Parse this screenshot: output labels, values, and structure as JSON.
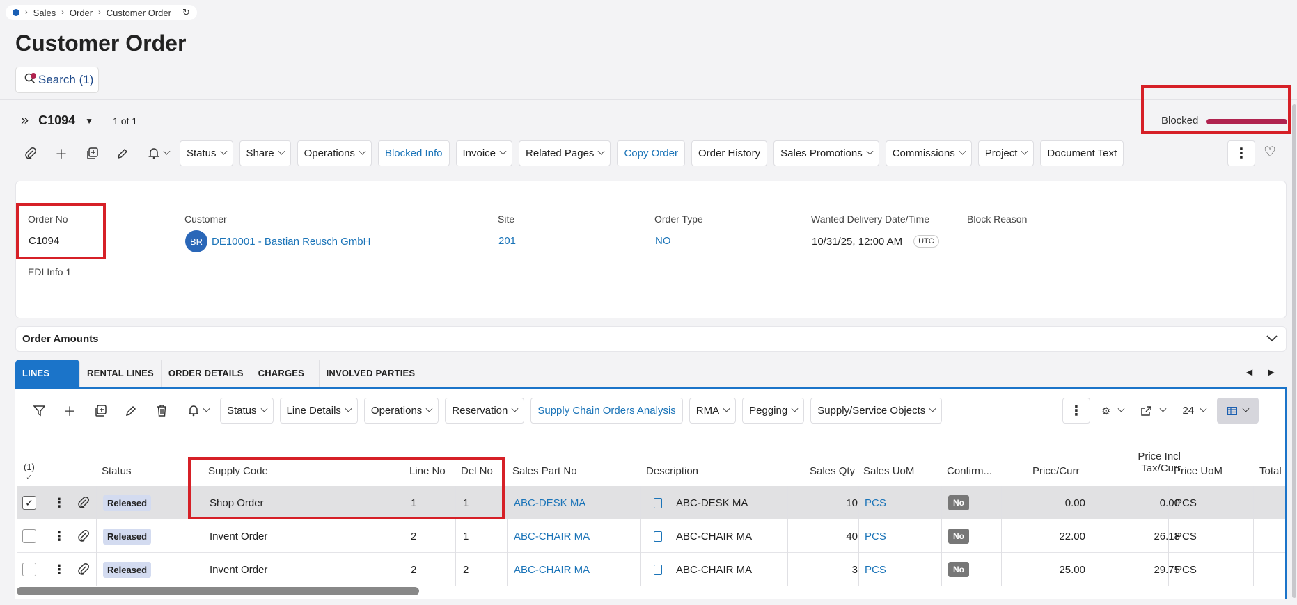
{
  "breadcrumb": {
    "items": [
      "Sales",
      "Order",
      "Customer Order"
    ]
  },
  "page": {
    "title": "Customer Order"
  },
  "search": {
    "label": "Search (1)"
  },
  "record": {
    "id": "C1094",
    "count": "1 of 1",
    "blocked_label": "Blocked"
  },
  "toolbar": {
    "buttons": [
      "Status",
      "Share",
      "Operations",
      "Blocked Info",
      "Invoice",
      "Related Pages",
      "Copy Order",
      "Order History",
      "Sales Promotions",
      "Commissions",
      "Project",
      "Document Text"
    ]
  },
  "header": {
    "order_no_label": "Order No",
    "order_no": "C1094",
    "edi_label": "EDI Info 1",
    "customer_label": "Customer",
    "customer_initials": "BR",
    "customer": "DE10001 - Bastian Reusch GmbH",
    "site_label": "Site",
    "site": "201",
    "order_type_label": "Order Type",
    "order_type": "NO",
    "delivery_label": "Wanted Delivery Date/Time",
    "delivery": "10/31/25, 12:00 AM",
    "tz": "UTC",
    "block_reason_label": "Block Reason"
  },
  "amounts": {
    "title": "Order Amounts"
  },
  "tabs": [
    "LINES",
    "RENTAL LINES",
    "ORDER DETAILS",
    "CHARGES",
    "INVOLVED PARTIES"
  ],
  "lines_toolbar": {
    "buttons": [
      "Status",
      "Line Details",
      "Operations",
      "Reservation",
      "Supply Chain Orders Analysis",
      "RMA",
      "Pegging",
      "Supply/Service Objects"
    ],
    "page_size": "24"
  },
  "table": {
    "selected_count": "(1)",
    "headers": {
      "status": "Status",
      "supply_code": "Supply Code",
      "line_no": "Line No",
      "del_no": "Del No",
      "part_no": "Sales Part No",
      "description": "Description",
      "qty": "Sales Qty",
      "uom": "Sales UoM",
      "confirm": "Confirm...",
      "price": "Price/Curr",
      "price_incl_1": "Price Incl",
      "price_incl_2": "Tax/Curr",
      "price_uom": "Price UoM",
      "total": "Total"
    },
    "rows": [
      {
        "status": "Released",
        "supply_code": "Shop Order",
        "line_no": "1",
        "del_no": "1",
        "part_no": "ABC-DESK MA",
        "description": "ABC-DESK MA",
        "qty": "10",
        "uom": "PCS",
        "confirm": "No",
        "price": "0.00",
        "price_incl": "0.00",
        "price_uom": "PCS"
      },
      {
        "status": "Released",
        "supply_code": "Invent Order",
        "line_no": "2",
        "del_no": "1",
        "part_no": "ABC-CHAIR MA",
        "description": "ABC-CHAIR MA",
        "qty": "40",
        "uom": "PCS",
        "confirm": "No",
        "price": "22.00",
        "price_incl": "26.18",
        "price_uom": "PCS"
      },
      {
        "status": "Released",
        "supply_code": "Invent Order",
        "line_no": "2",
        "del_no": "2",
        "part_no": "ABC-CHAIR MA",
        "description": "ABC-CHAIR MA",
        "qty": "3",
        "uom": "PCS",
        "confirm": "No",
        "price": "25.00",
        "price_incl": "29.75",
        "price_uom": "PCS"
      }
    ]
  },
  "colors": {
    "accent": "#1b74c9",
    "link": "#1b74b8",
    "blocked": "#b0234f",
    "highlight": "#d62027"
  }
}
